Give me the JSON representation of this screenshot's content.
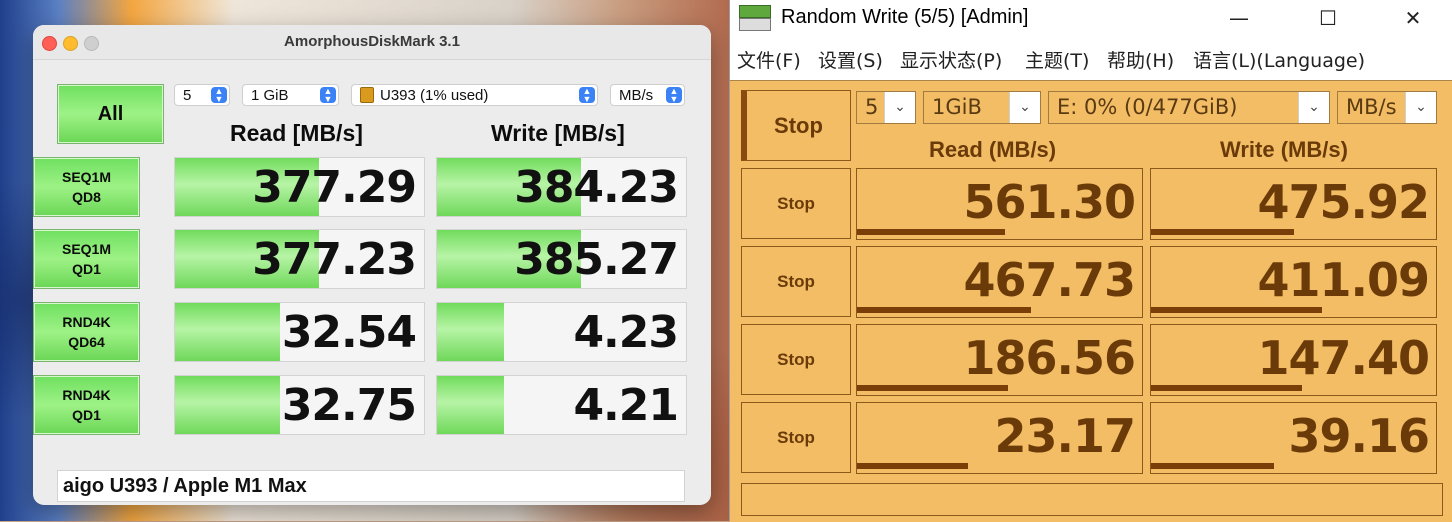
{
  "mac_app": {
    "title": "AmorphousDiskMark 3.1",
    "all_label": "All",
    "count_value": "5",
    "size_value": "1 GiB",
    "drive_value": "U393 (1% used)",
    "unit_value": "MB/s",
    "read_header": "Read [MB/s]",
    "write_header": "Write [MB/s]",
    "tests": [
      {
        "line1": "SEQ1M",
        "line2": "QD8",
        "read": "377.29",
        "write": "384.23",
        "read_fill": 0.58,
        "write_fill": 0.58
      },
      {
        "line1": "SEQ1M",
        "line2": "QD1",
        "read": "377.23",
        "write": "385.27",
        "read_fill": 0.58,
        "write_fill": 0.58
      },
      {
        "line1": "RND4K",
        "line2": "QD64",
        "read": "32.54",
        "write": "4.23",
        "read_fill": 0.42,
        "write_fill": 0.27
      },
      {
        "line1": "RND4K",
        "line2": "QD1",
        "read": "32.75",
        "write": "4.21",
        "read_fill": 0.42,
        "write_fill": 0.27
      }
    ],
    "comment": "aigo U393 / Apple M1 Max"
  },
  "win_app": {
    "title": "Random Write (5/5) [Admin]",
    "controls": {
      "minimize": "—",
      "maximize": "☐",
      "close": "✕"
    },
    "menu": [
      "文件(F)",
      "设置(S)",
      "显示状态(P)",
      "主题(T)",
      "帮助(H)",
      "语言(L)(Language)"
    ],
    "main_button": "Stop",
    "count_value": "5",
    "size_value": "1GiB",
    "drive_value": "E: 0% (0/477GiB)",
    "unit_value": "MB/s",
    "read_header": "Read (MB/s)",
    "write_header": "Write (MB/s)",
    "rows": [
      {
        "button": "Stop",
        "read": "561.30",
        "write": "475.92",
        "read_fill": 0.52,
        "write_fill": 0.5
      },
      {
        "button": "Stop",
        "read": "467.73",
        "write": "411.09",
        "read_fill": 0.61,
        "write_fill": 0.6
      },
      {
        "button": "Stop",
        "read": "186.56",
        "write": "147.40",
        "read_fill": 0.53,
        "write_fill": 0.53
      },
      {
        "button": "Stop",
        "read": "23.17",
        "write": "39.16",
        "read_fill": 0.39,
        "write_fill": 0.43
      }
    ],
    "colors": {
      "panel": "#f2bd65",
      "text": "#6b3a09",
      "bar": "#7a3e08"
    }
  }
}
